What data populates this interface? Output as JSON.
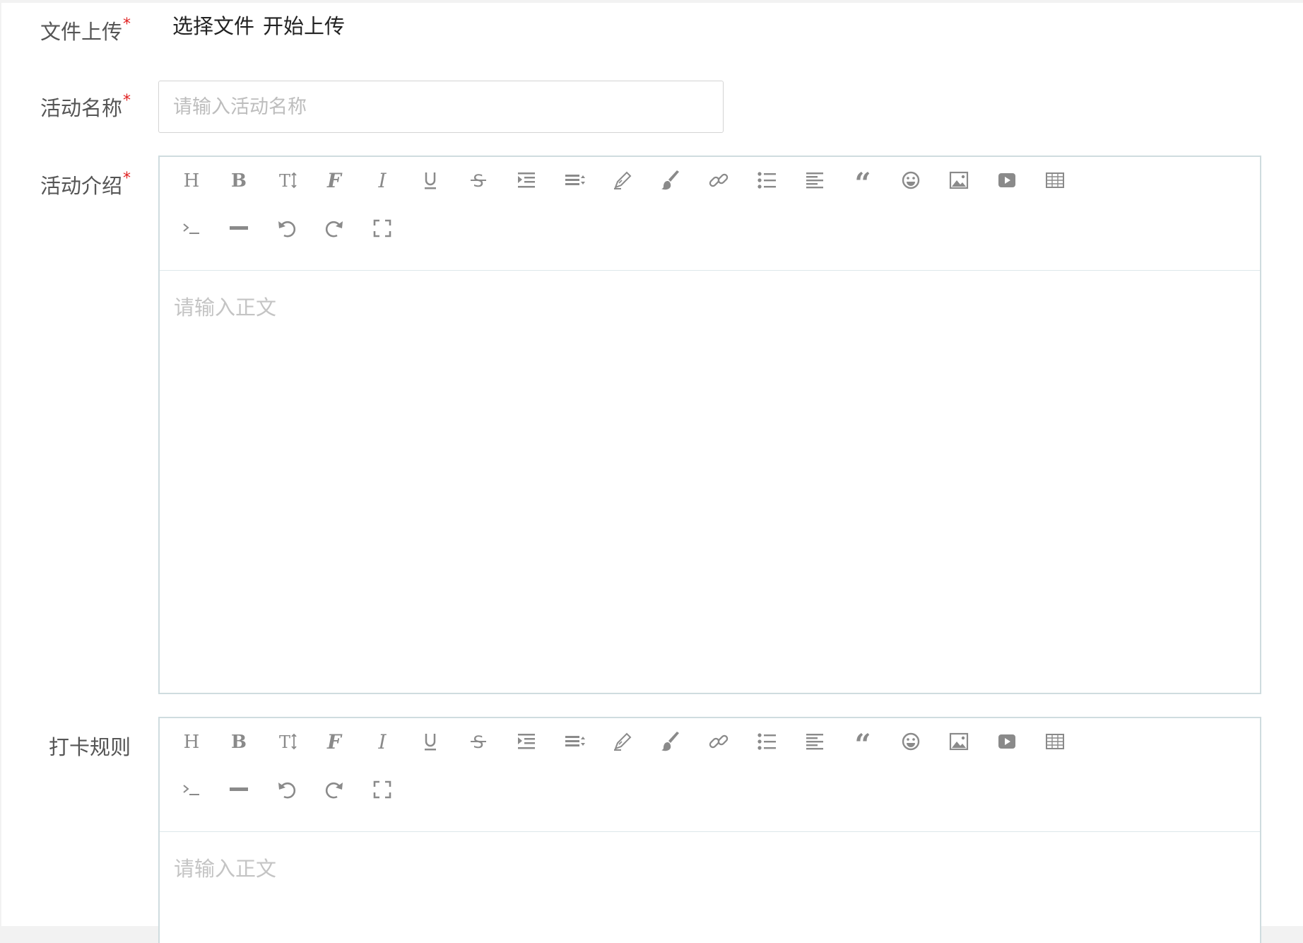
{
  "form": {
    "upload": {
      "label": "文件上传",
      "required_mark": "*",
      "choose_file": "选择文件",
      "start_upload": "开始上传"
    },
    "activity_name": {
      "label": "活动名称",
      "required_mark": "*",
      "placeholder": "请输入活动名称",
      "value": ""
    },
    "activity_intro": {
      "label": "活动介绍",
      "required_mark": "*",
      "placeholder": "请输入正文"
    },
    "checkin_rules": {
      "label": "打卡规则",
      "placeholder": "请输入正文"
    }
  },
  "toolbar_icons": [
    "heading-icon",
    "bold-icon",
    "font-size-icon",
    "font-family-icon",
    "italic-icon",
    "underline-icon",
    "strikethrough-icon",
    "indent-icon",
    "line-height-icon",
    "font-color-icon",
    "background-color-icon",
    "link-icon",
    "list-icon",
    "justify-icon",
    "quote-icon",
    "emoji-icon",
    "image-icon",
    "video-icon",
    "table-icon",
    "code-icon",
    "divider-icon",
    "undo-icon",
    "redo-icon",
    "fullscreen-icon"
  ],
  "colors": {
    "required": "#e02020",
    "editor_border": "#cfdcdf",
    "icon": "#8a8a8a",
    "placeholder": "#c4c4c4"
  }
}
